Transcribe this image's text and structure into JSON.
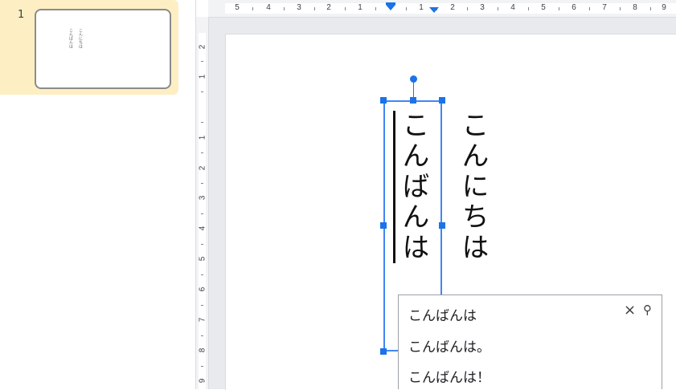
{
  "filmstrip": {
    "slide_number": "1",
    "thumb_text_col1": "こんばんは",
    "thumb_text_col2": "こんにちは"
  },
  "ruler_horizontal": {
    "labels": [
      "5",
      "4",
      "3",
      "2",
      "1",
      "1",
      "2",
      "3",
      "4",
      "5",
      "6",
      "7",
      "8",
      "9"
    ]
  },
  "ruler_vertical": {
    "labels": [
      "2",
      "1",
      "1",
      "2",
      "3",
      "4",
      "5",
      "6",
      "7",
      "8",
      "9"
    ]
  },
  "slide": {
    "selected_text": "こんばんは",
    "other_text": "こんにちは"
  },
  "autocomplete": {
    "suggestions": [
      "こんばんは",
      "こんばんは。",
      "こんばんは！"
    ],
    "close_icon": "×",
    "search_icon": "⚲"
  },
  "colors": {
    "selection_blue": "#1a73e8",
    "filmstrip_selected": "#fdefc3"
  }
}
